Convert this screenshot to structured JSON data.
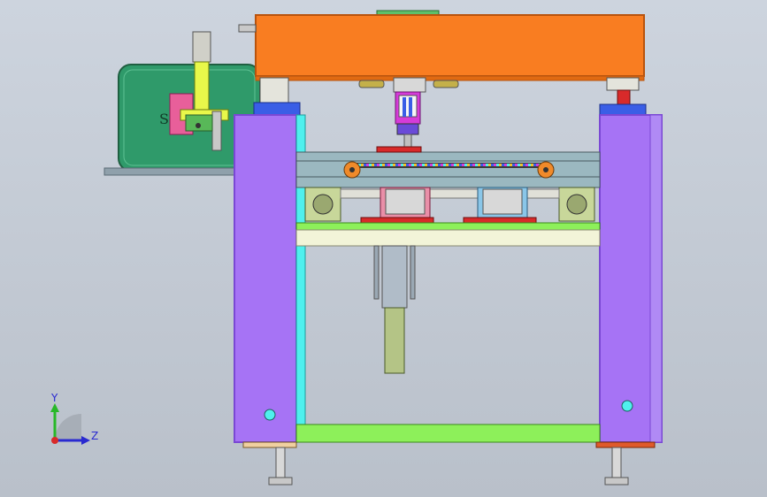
{
  "viewport": {
    "background_top": "#cdd4de",
    "background_bottom": "#b9c0ca"
  },
  "colors": {
    "frame_column": "#a673f5",
    "frame_column_edge": "#7a48d4",
    "top_beam": "#f97d21",
    "top_beam_edge": "#b8530d",
    "cover_box": "#2f9a6a",
    "cover_box_edge": "#1f5f41",
    "lower_beam": "#8df05a",
    "cyan_plate": "#4ff0ee",
    "cream_plate": "#f2f4d8",
    "conveyor": "#9bb8c0",
    "motor_body": "#c8d79a",
    "vertical_arm": "#e8f84a",
    "magenta_part": "#d63bd9",
    "red_part": "#d82a2a",
    "blue_part": "#3a5ee6"
  },
  "labels": {
    "cover_letter": "S",
    "axis_y": "Y",
    "axis_z": "Z"
  },
  "icons": {
    "triad": "coordinate-triad-icon",
    "sprocket": "sprocket-icon"
  }
}
